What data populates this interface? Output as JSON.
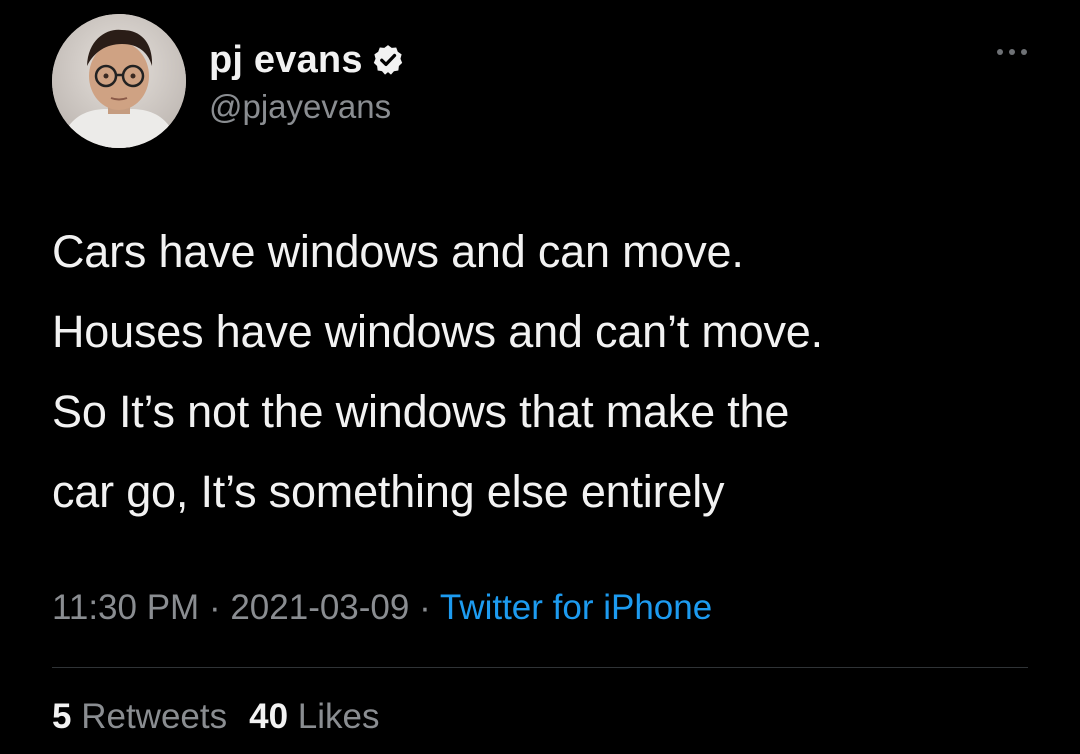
{
  "author": {
    "display_name": "pj evans",
    "handle": "@pjayevans",
    "verified": true,
    "avatar_icon": "profile-photo"
  },
  "tweet": {
    "lines": [
      "Cars have windows and can move.",
      "Houses have windows and can’t move.",
      "So It’s not the windows that make the",
      "car go, It’s something else entirely"
    ],
    "time": "11:30 PM",
    "date": "2021-03-09",
    "separator": " · ",
    "source": "Twitter for iPhone"
  },
  "stats": {
    "retweets_count": "5",
    "retweets_label": "Retweets",
    "likes_count": "40",
    "likes_label": "Likes"
  },
  "colors": {
    "background": "#000000",
    "text": "#f2f2f2",
    "muted": "#8a8d91",
    "link": "#1d9bf0"
  }
}
